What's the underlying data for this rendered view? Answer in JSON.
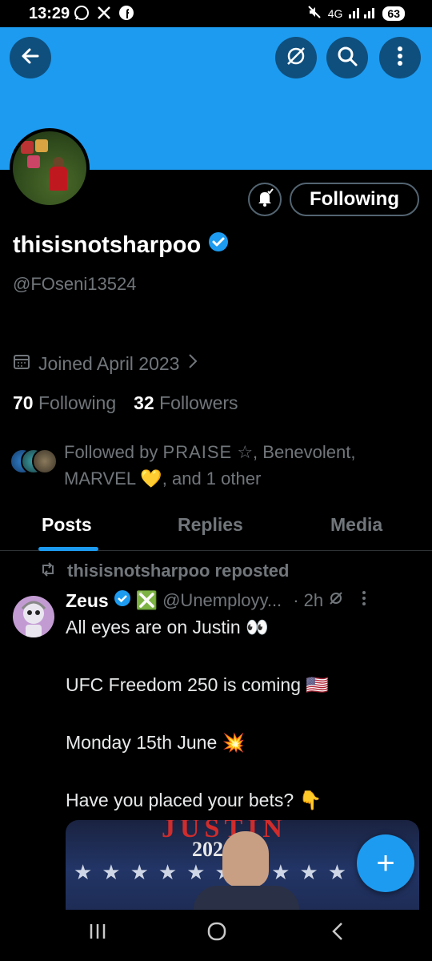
{
  "status_bar": {
    "time": "13:29",
    "network": "4G",
    "battery": "63",
    "app_icons": [
      "whatsapp-icon",
      "x-icon",
      "facebook-icon"
    ]
  },
  "header": {
    "buttons": [
      "back-icon",
      "grok-icon",
      "search-icon",
      "more-icon"
    ],
    "banner_color": "#1d9bf0"
  },
  "profile": {
    "name": "thisisnotsharpoo",
    "verified": true,
    "handle": "@FOseni13524",
    "joined": "Joined April 2023",
    "following_count": "70",
    "following_label": "Following",
    "followers_count": "32",
    "followers_label": "Followers",
    "follow_button": "Following",
    "followed_by_prefix": "Followed by ",
    "followed_by_name1": "PRAISE",
    "followed_by_rest_line1": " ☆, Benevolent,",
    "followed_by_line2": "MARVEL 💛, and 1 other"
  },
  "tabs": [
    {
      "label": "Posts",
      "active": true
    },
    {
      "label": "Replies",
      "active": false
    },
    {
      "label": "Media",
      "active": false
    }
  ],
  "post": {
    "repost_text": "thisisnotsharpoo reposted",
    "author": "Zeus",
    "author_emoji": "❎",
    "handle": "@Unemployy...",
    "time": "· 2h",
    "lines": [
      "All eyes are on Justin 👀",
      "UFC Freedom 250 is coming 🇺🇸",
      "Monday 15th June 💥",
      "Have you placed your bets? 👇"
    ],
    "media_banner": "JUSTIN",
    "media_year": "202"
  },
  "fab": {
    "label": "+"
  },
  "colors": {
    "accent": "#1d9bf0",
    "background": "#000000",
    "muted": "#71767b"
  }
}
